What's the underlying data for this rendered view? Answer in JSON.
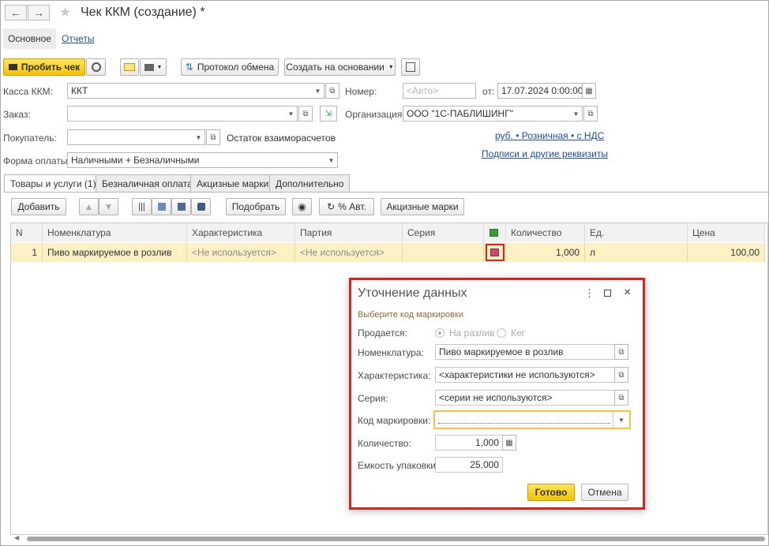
{
  "window": {
    "title": "Чек ККМ (создание) *",
    "nav_back": "←",
    "nav_forward": "→",
    "star": "★"
  },
  "top_tabs": {
    "main": "Основное",
    "reports": "Отчеты"
  },
  "toolbar": {
    "punch_check": "Пробить чек",
    "exchange_log": "Протокол обмена",
    "create_based_on": "Создать на основании"
  },
  "form": {
    "kassa_label": "Касса ККМ:",
    "kassa_value": "ККТ",
    "number_label": "Номер:",
    "number_placeholder": "<Авто>",
    "from_label": "от:",
    "date_value": "17.07.2024  0:00:00",
    "order_label": "Заказ:",
    "order_value": "",
    "org_label": "Организация:",
    "org_value": "ООО \"1С-ПАБЛИШИНГ\"",
    "buyer_label": "Покупатель:",
    "buyer_value": "",
    "balance_label": "Остаток взаиморасчетов",
    "price_type_link": "руб. • Розничная • с НДС",
    "signatures_link": "Подписи и другие реквизиты",
    "payment_label": "Форма оплаты:",
    "payment_value": "Наличными + Безналичными"
  },
  "page_tabs": [
    "Товары и услуги (1)",
    "Безналичная оплата",
    "Акцизные марки",
    "Дополнительно"
  ],
  "table_toolbar": {
    "add": "Добавить",
    "pick": "Подобрать",
    "percent_auto": "% Авт.",
    "excise_marks": "Акцизные марки"
  },
  "table": {
    "columns": [
      "N",
      "Номенклатура",
      "Характеристика",
      "Партия",
      "Серия",
      "",
      "Количество",
      "Ед.",
      "Цена"
    ],
    "rows": [
      {
        "n": "1",
        "item": "Пиво маркируемое в розлив",
        "characteristic": "<Не используется>",
        "batch": "<Не используется>",
        "series": "",
        "qty": "1,000",
        "unit": "л",
        "price": "100,00"
      }
    ]
  },
  "dialog": {
    "title": "Уточнение данных",
    "subtitle": "Выберите код маркировки",
    "sold_label": "Продается:",
    "radio_draft": "На разлив",
    "radio_keg": "Кег",
    "item_label": "Номенклатура:",
    "item_value": "Пиво маркируемое в розлив",
    "char_label": "Характеристика:",
    "char_value": "<характеристики не используются>",
    "series_label": "Серия:",
    "series_value": "<серии не используются>",
    "code_label": "Код маркировки:",
    "code_value": "",
    "qty_label": "Количество:",
    "qty_value": "1,000",
    "capacity_label": "Емкость упаковки:",
    "capacity_value": "25,000",
    "ok": "Готово",
    "cancel": "Отмена"
  },
  "colors": {
    "accent_yellow": "#f3c300",
    "highlight_red": "#e0201b",
    "row_highlight": "#fbf1c5",
    "link": "#1c4ea6"
  }
}
